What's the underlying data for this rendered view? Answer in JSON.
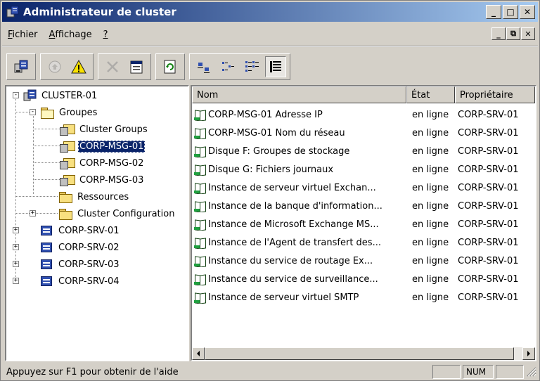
{
  "window": {
    "title": "Administrateur de cluster",
    "caption": {
      "minimize": "_",
      "maximize": "□",
      "close": "✕"
    }
  },
  "menubar": {
    "items": [
      {
        "label": "Fichier",
        "accel": "F",
        "rest": "ichier"
      },
      {
        "label": "Affichage",
        "accel": "A",
        "rest": "ffichage"
      },
      {
        "label": "?",
        "accel": "?",
        "rest": ""
      }
    ],
    "mdi": {
      "minimize": "_",
      "restore": "⧉",
      "close": "✕"
    }
  },
  "toolbar": {
    "buttons": [
      {
        "name": "open-connection-icon"
      },
      {
        "name": "bring-online-icon",
        "disabled": true
      },
      {
        "name": "take-offline-icon"
      },
      {
        "name": "delete-icon",
        "disabled": true
      },
      {
        "name": "properties-icon"
      },
      {
        "name": "refresh-icon"
      },
      {
        "name": "large-icons-view-icon"
      },
      {
        "name": "small-icons-view-icon"
      },
      {
        "name": "list-view-icon"
      },
      {
        "name": "details-view-icon",
        "pressed": true
      }
    ]
  },
  "tree": {
    "nodes": [
      {
        "label": "CLUSTER-01",
        "icon": "cluster-icon",
        "expander": "-"
      },
      {
        "label": "Groupes",
        "icon": "folder-open-icon",
        "expander": "-"
      },
      {
        "label": "Cluster Groups",
        "icon": "group-icon"
      },
      {
        "label": "CORP-MSG-01",
        "icon": "group-icon",
        "selected": true
      },
      {
        "label": "CORP-MSG-02",
        "icon": "group-icon"
      },
      {
        "label": "CORP-MSG-03",
        "icon": "group-icon"
      },
      {
        "label": "Ressources",
        "icon": "folder-icon"
      },
      {
        "label": "Cluster Configuration",
        "icon": "folder-icon",
        "expander": "+"
      },
      {
        "label": "CORP-SRV-01",
        "icon": "server-icon",
        "expander": "+"
      },
      {
        "label": "CORP-SRV-02",
        "icon": "server-icon",
        "expander": "+"
      },
      {
        "label": "CORP-SRV-03",
        "icon": "server-icon",
        "expander": "+"
      },
      {
        "label": "CORP-SRV-04",
        "icon": "server-icon",
        "expander": "+"
      }
    ]
  },
  "list": {
    "columns": [
      "Nom",
      "État",
      "Propriétaire"
    ],
    "rows": [
      {
        "name": "CORP-MSG-01 Adresse IP",
        "state": "en ligne",
        "owner": "CORP-SRV-01"
      },
      {
        "name": "CORP-MSG-01 Nom du réseau",
        "state": "en ligne",
        "owner": "CORP-SRV-01"
      },
      {
        "name": "Disque F: Groupes de stockage",
        "state": "en ligne",
        "owner": "CORP-SRV-01"
      },
      {
        "name": "Disque G: Fichiers journaux",
        "state": "en ligne",
        "owner": "CORP-SRV-01"
      },
      {
        "name": "Instance de serveur virtuel Exchan...",
        "state": "en ligne",
        "owner": "CORP-SRV-01"
      },
      {
        "name": "Instance de la banque d'information...",
        "state": "en ligne",
        "owner": "CORP-SRV-01"
      },
      {
        "name": "Instance de Microsoft Exchange MS...",
        "state": "en ligne",
        "owner": "CORP-SRV-01"
      },
      {
        "name": "Instance de l'Agent de transfert des...",
        "state": "en ligne",
        "owner": "CORP-SRV-01"
      },
      {
        "name": "Instance du service de routage Ex...",
        "state": "en ligne",
        "owner": "CORP-SRV-01"
      },
      {
        "name": "Instance du service de surveillance...",
        "state": "en ligne",
        "owner": "CORP-SRV-01"
      },
      {
        "name": "Instance de serveur virtuel SMTP",
        "state": "en ligne",
        "owner": "CORP-SRV-01"
      }
    ]
  },
  "statusbar": {
    "text": "Appuyez sur F1 pour obtenir de l'aide",
    "num": "NUM"
  },
  "colors": {
    "titlebar_start": "#0a246a",
    "titlebar_end": "#a6caf0",
    "selection": "#0a246a",
    "face": "#d4d0c8"
  }
}
